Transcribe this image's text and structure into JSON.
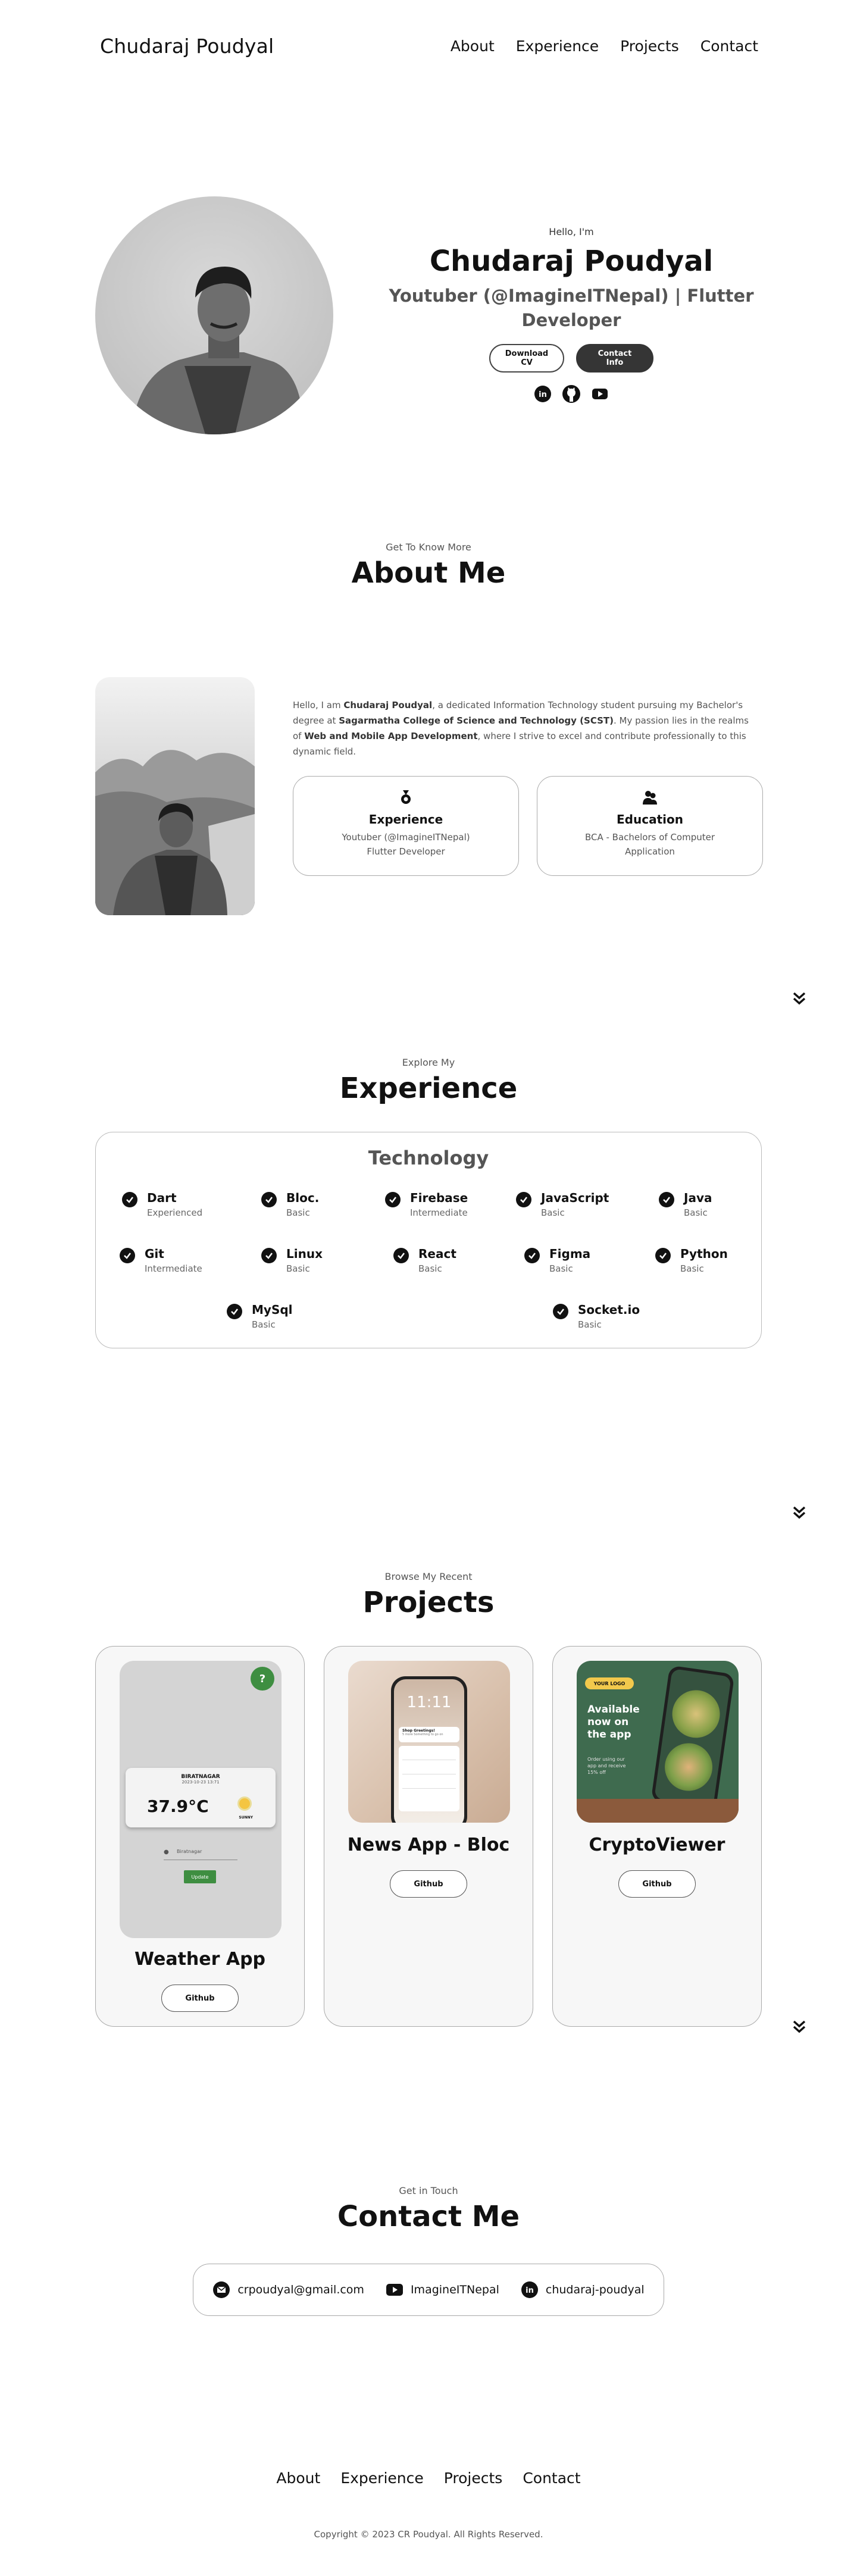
{
  "nav": {
    "logo": "Chudaraj Poudyal",
    "links": [
      "About",
      "Experience",
      "Projects",
      "Contact"
    ]
  },
  "hero": {
    "greeting": "Hello, I'm",
    "name": "Chudaraj Poudyal",
    "role": "Youtuber (@ImagineITNepal) | Flutter Developer",
    "download_cv": "Download CV",
    "contact_info": "Contact Info",
    "socials": [
      "linkedin-icon",
      "github-icon",
      "youtube-icon"
    ]
  },
  "about": {
    "subtitle": "Get To Know More",
    "title": "About Me",
    "text_1": "Hello, I am ",
    "text_name": "Chudaraj Poudyal",
    "text_2": ", a dedicated Information Technology student pursuing my Bachelor's degree at ",
    "text_college": "Sagarmatha College of Science and Technology (SCST)",
    "text_3": ". My passion lies in the realms of ",
    "text_field": "Web and Mobile App Development",
    "text_4": ", where I strive to excel and contribute professionally to this dynamic field.",
    "experience_card": {
      "title": "Experience",
      "line1": "Youtuber (@ImagineITNepal)",
      "line2": "Flutter Developer"
    },
    "education_card": {
      "title": "Education",
      "line1": "BCA - Bachelors of Computer",
      "line2": "Application"
    }
  },
  "experience": {
    "subtitle": "Explore My",
    "title": "Experience",
    "box_title": "Technology",
    "skills": [
      {
        "name": "Dart",
        "level": "Experienced"
      },
      {
        "name": "Bloc.",
        "level": "Basic"
      },
      {
        "name": "Firebase",
        "level": "Intermediate"
      },
      {
        "name": "JavaScript",
        "level": "Basic"
      },
      {
        "name": "Java",
        "level": "Basic"
      },
      {
        "name": "Git",
        "level": "Intermediate"
      },
      {
        "name": "Linux",
        "level": "Basic"
      },
      {
        "name": "React",
        "level": "Basic"
      },
      {
        "name": "Figma",
        "level": "Basic"
      },
      {
        "name": "Python",
        "level": "Basic"
      },
      {
        "name": "MySql",
        "level": "Basic"
      },
      {
        "name": "Socket.io",
        "level": "Basic"
      }
    ]
  },
  "projects": {
    "subtitle": "Browse My Recent",
    "title": "Projects",
    "items": [
      {
        "title": "Weather App",
        "button": "Github"
      },
      {
        "title": "News App - Bloc",
        "button": "Github"
      },
      {
        "title": "CryptoViewer",
        "button": "Github"
      }
    ],
    "weather_mock": {
      "city": "BIRATNAGAR",
      "date": "2023-10-23 13:71",
      "temp": "37.9°C",
      "condition": "SUNNY",
      "field": "Biratnagar",
      "button": "Update"
    },
    "news_mock": {
      "time": "11:11",
      "heading": "Shop Greetings!",
      "sub": "5 more Something to go on"
    },
    "crypto_mock": {
      "badge": "YOUR LOGO",
      "headline": "Available now on the app",
      "text": "Order using our app and receive 15% off"
    }
  },
  "contact": {
    "subtitle": "Get in Touch",
    "title": "Contact Me",
    "email": "crpoudyal@gmail.com",
    "youtube": "ImagineITNepal",
    "linkedin": "chudaraj-poudyal"
  },
  "footer": {
    "links": [
      "About",
      "Experience",
      "Projects",
      "Contact"
    ],
    "copyright": "Copyright © 2023 CR Poudyal. All Rights Reserved."
  }
}
